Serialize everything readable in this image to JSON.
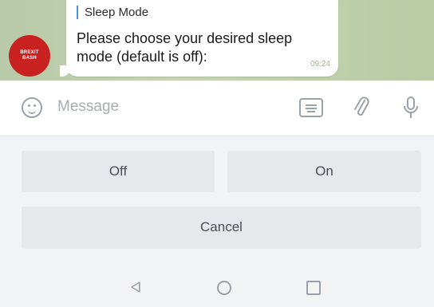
{
  "chat": {
    "avatar_text": "BREXIT BASH",
    "reply_title": "Sleep Mode",
    "message": "Please choose your desired sleep mode (default is off):",
    "time": "09:24"
  },
  "input": {
    "placeholder": "Message"
  },
  "keyboard": {
    "buttons": [
      "Off",
      "On",
      "Cancel"
    ]
  },
  "icons": {
    "emoji": "emoji-icon",
    "keyboard": "keyboard-icon",
    "attach": "paperclip-icon",
    "mic": "microphone-icon",
    "nav_back": "back-triangle-icon",
    "nav_home": "home-circle-icon",
    "nav_recent": "recent-square-icon"
  },
  "colors": {
    "avatar_bg": "#c8211f",
    "reply_bar": "#4a90d9",
    "icon_gray": "#9aa1a8"
  }
}
